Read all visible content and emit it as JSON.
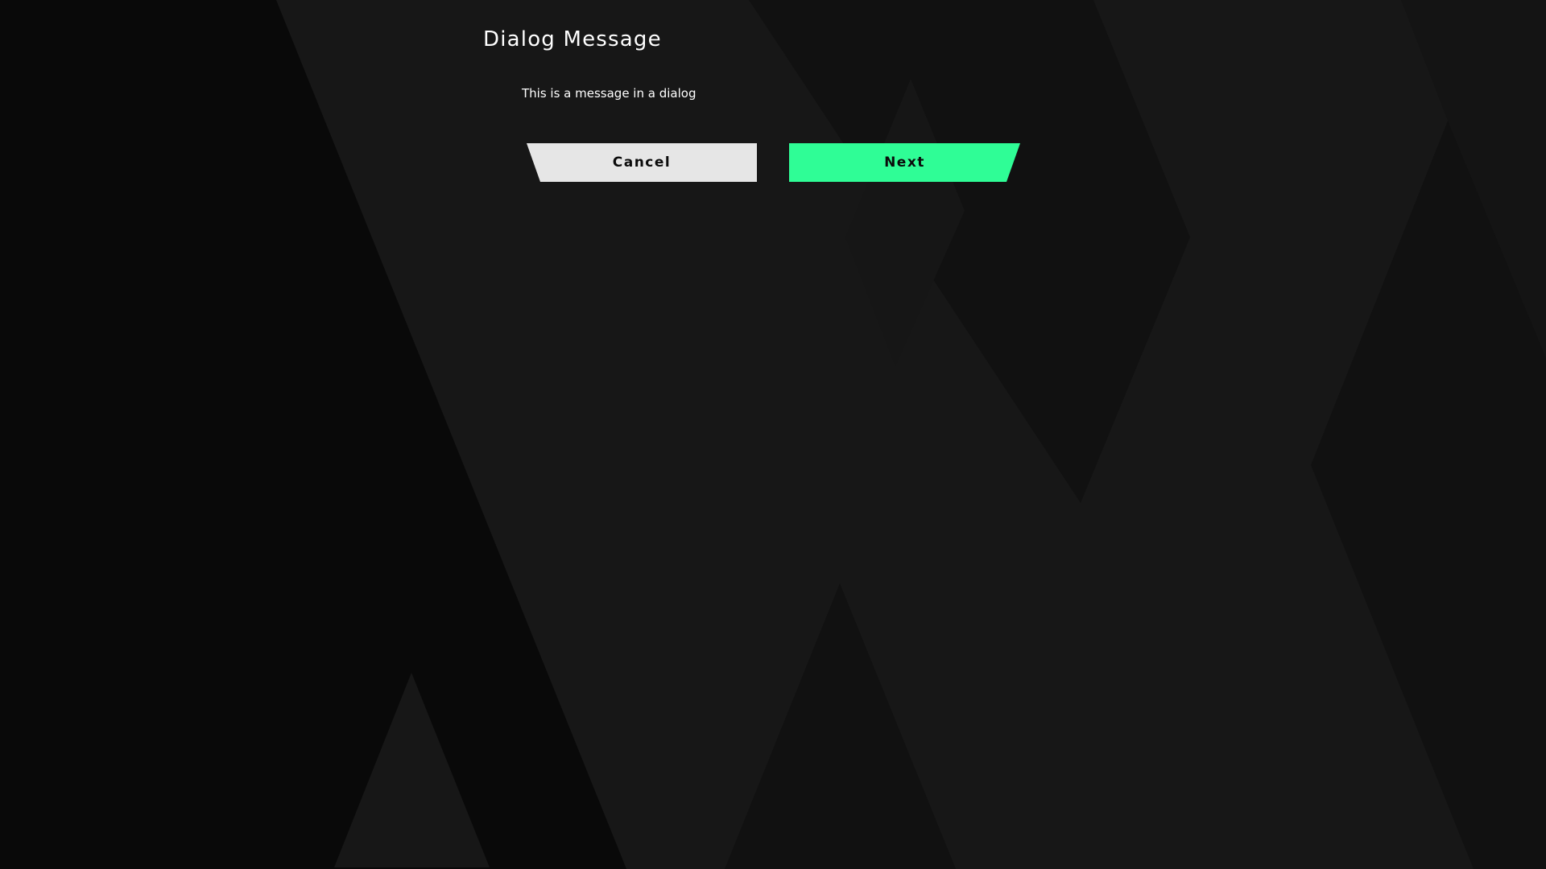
{
  "dialog": {
    "title": "Dialog Message",
    "message": "This is a message in a dialog"
  },
  "actions": {
    "cancel_label": "Cancel",
    "next_label": "Next"
  },
  "colors": {
    "background": "#161616",
    "cancel_button": "#e6e6e6",
    "next_button": "#2ffd96",
    "text_primary": "#ffffff",
    "button_text": "#0b0b0b"
  }
}
